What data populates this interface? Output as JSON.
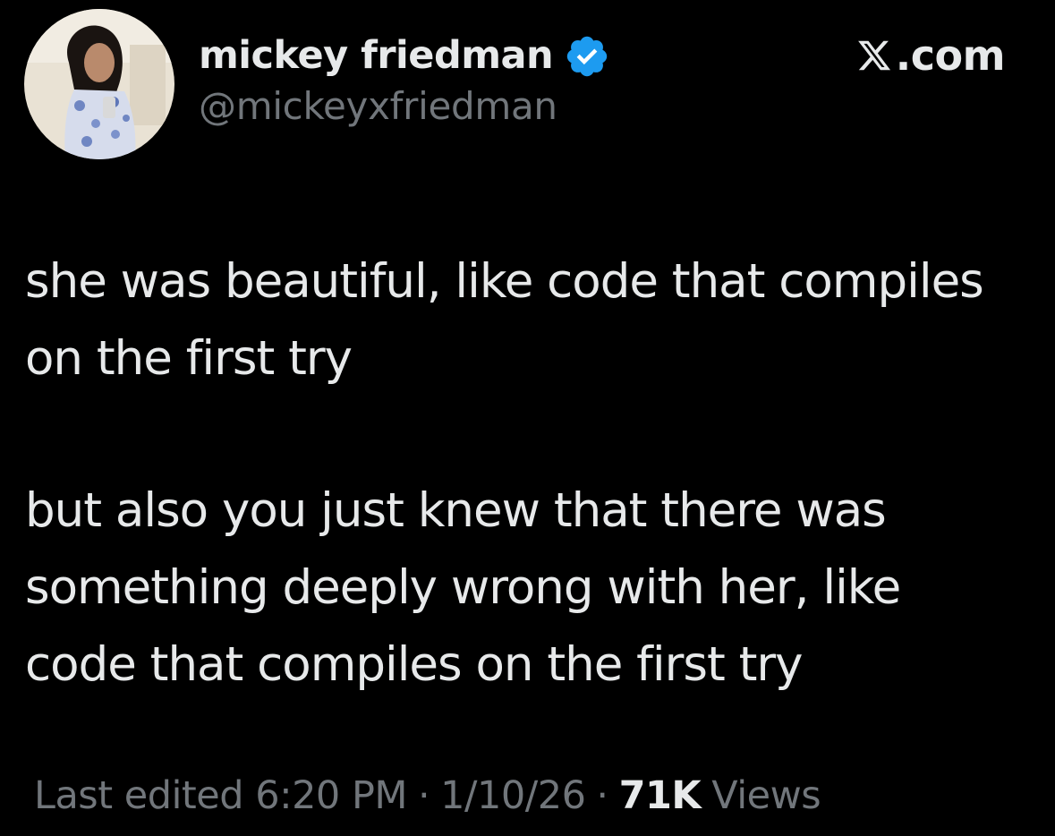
{
  "tweet": {
    "author": {
      "display_name": "mickey friedman",
      "handle": "@mickeyxfriedman",
      "verified": true,
      "verified_badge_color": "#1d9bf0",
      "avatar_icon": "profile-photo"
    },
    "brand": {
      "logo_icon": "x-logo-icon",
      "domain": ".com"
    },
    "text": {
      "paragraph_1": "she was beautiful, like code that compiles on the first try",
      "paragraph_2": "but also you just knew that there was something deeply wrong with her, like code that compiles on the first try"
    },
    "meta": {
      "edit_label": "Last edited",
      "time": "6:20 PM",
      "separator": "·",
      "date": "1/10/26",
      "views_count": "71K",
      "views_label": "Views"
    }
  },
  "colors": {
    "background": "#000000",
    "primary_text": "#e7e9ea",
    "secondary_text": "#71767b",
    "verified_blue": "#1d9bf0"
  }
}
